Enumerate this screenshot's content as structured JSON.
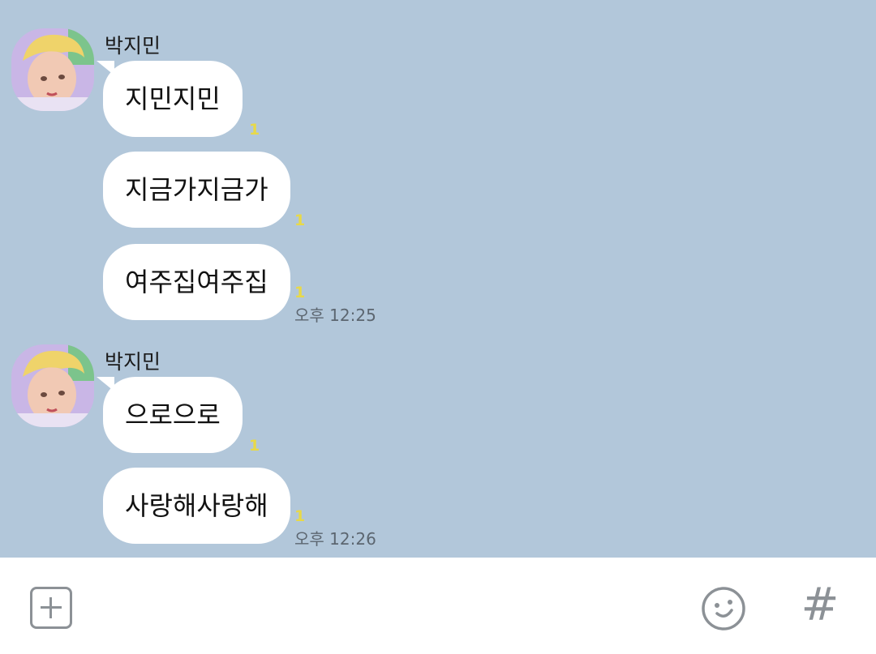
{
  "groups": [
    {
      "sender": "박지민",
      "messages": [
        {
          "text": "지민지민",
          "unread": "1"
        },
        {
          "text": "지금가지금가",
          "unread": "1"
        },
        {
          "text": "여주집여주집",
          "unread": "1",
          "time": "오후 12:25"
        }
      ]
    },
    {
      "sender": "박지민",
      "messages": [
        {
          "text": "으로으로",
          "unread": "1"
        },
        {
          "text": "사랑해사랑해",
          "unread": "1",
          "time": "오후 12:26"
        }
      ]
    }
  ],
  "input_bar": {
    "add_icon": "plus-square-icon",
    "emoji_icon": "smiley-icon",
    "hash_label": "#"
  },
  "colors": {
    "chat_background": "#b2c7da",
    "bubble": "#ffffff",
    "unread_count": "#e8d948",
    "icon": "#8c9196"
  }
}
